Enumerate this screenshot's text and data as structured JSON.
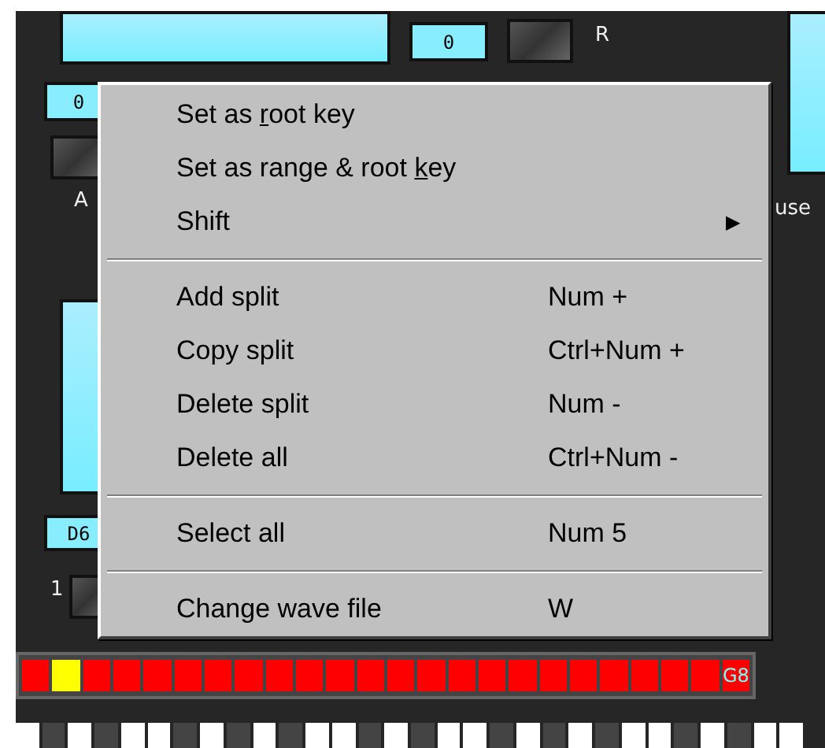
{
  "panel": {
    "top_value": "0",
    "top_label": "R",
    "left_value": "0",
    "left_label": "A",
    "right_label": "use",
    "lower_value": "D6",
    "lower_label": "1"
  },
  "key_strip": [
    {
      "selected": false
    },
    {
      "selected": true
    },
    {
      "selected": false
    },
    {
      "selected": false
    },
    {
      "selected": false
    },
    {
      "selected": false
    },
    {
      "selected": false
    },
    {
      "selected": false
    },
    {
      "selected": false
    },
    {
      "selected": false
    },
    {
      "selected": false
    },
    {
      "selected": false
    },
    {
      "selected": false
    },
    {
      "selected": false
    },
    {
      "selected": false
    },
    {
      "selected": false
    },
    {
      "selected": false
    },
    {
      "selected": false
    },
    {
      "selected": false
    },
    {
      "selected": false
    },
    {
      "selected": false
    },
    {
      "selected": false
    },
    {
      "selected": false
    },
    {
      "selected": false,
      "label": "G8"
    }
  ],
  "context_menu": [
    {
      "kind": "item",
      "label_parts": [
        "Set as ",
        "r",
        "oot key"
      ]
    },
    {
      "kind": "item",
      "label_parts": [
        "Set as range & root ",
        "k",
        "ey"
      ]
    },
    {
      "kind": "submenu",
      "label_parts": [
        "Shift"
      ],
      "arrow": "▶"
    },
    {
      "kind": "separator"
    },
    {
      "kind": "item",
      "label_parts": [
        "Add split"
      ],
      "shortcut": "Num +"
    },
    {
      "kind": "item",
      "label_parts": [
        "Copy split"
      ],
      "shortcut": "Ctrl+Num +"
    },
    {
      "kind": "item",
      "label_parts": [
        "Delete split"
      ],
      "shortcut": "Num -"
    },
    {
      "kind": "item",
      "label_parts": [
        "Delete all"
      ],
      "shortcut": "Ctrl+Num -"
    },
    {
      "kind": "separator"
    },
    {
      "kind": "item",
      "label_parts": [
        "Select all"
      ],
      "shortcut": "Num 5"
    },
    {
      "kind": "separator"
    },
    {
      "kind": "item",
      "label_parts": [
        "Change wave file"
      ],
      "shortcut": "W"
    }
  ]
}
